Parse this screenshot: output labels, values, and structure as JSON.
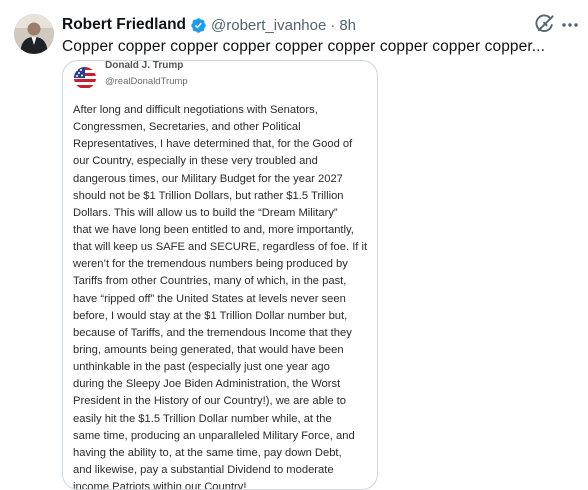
{
  "tweet": {
    "display_name": "Robert Friedland",
    "handle": "@robert_ivanhoe",
    "separator": "·",
    "time": "8h",
    "text": "Copper copper copper copper copper copper copper copper copper..."
  },
  "embedded_post": {
    "author_name_partial": "Donald J. Trump",
    "handle": "@realDonaldTrump",
    "lines": [
      "After long and difficult negotiations with Senators,",
      "Congressmen, Secretaries, and other Political",
      "Representatives, I have determined that, for the Good of",
      "our Country, especially in these very troubled and",
      "dangerous times, our Military Budget for the year 2027",
      "should not be $1 Trillion Dollars, but rather $1.5 Trillion",
      "Dollars. This will allow us to build the “Dream Military”",
      "that we have long been entitled to and, more importantly,",
      "that will keep us SAFE and SECURE, regardless of foe. If it",
      "weren’t for the tremendous numbers being produced by",
      "Tariffs from other Countries, many of which, in the past,",
      "have “ripped off” the United States at levels never seen",
      "before, I would stay at the $1 Trillion Dollar number but,",
      "because of Tariffs, and the tremendous Income that they",
      "bring, amounts being generated, that would have been",
      "unthinkable in the past (especially just one year ago",
      "during the Sleepy Joe Biden Administration, the Worst",
      "President in the History of our Country!), we are able to",
      "easily hit the $1.5 Trillion Dollar number while, at the",
      "same time, producing an unparalleled Military Force, and",
      "having the ability to, at the same time, pay down Debt,",
      "and likewise, pay a substantial Dividend to moderate",
      "income Patriots within our Country!"
    ]
  },
  "colors": {
    "verified_badge": "#1d9bf0",
    "secondary_text": "#536471",
    "card_border": "#cfd9de"
  },
  "icons": {
    "verified": "verified-badge-icon",
    "grok": "grok-icon",
    "more": "more-options-icon"
  }
}
